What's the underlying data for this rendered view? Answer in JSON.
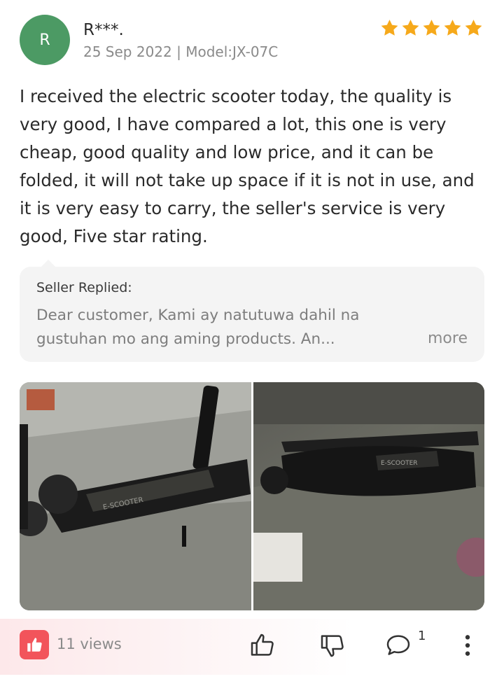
{
  "review": {
    "avatar_initial": "R",
    "username": "R***.",
    "meta": "25 Sep 2022 | Model:JX-07C",
    "rating": 5,
    "text": "I received the electric scooter today, the quality is very good, I have compared a lot, this one is very cheap, good quality and low price, and it can be folded, it will not take up space if it is not in use, and it is very easy to carry, the seller's service is very good, Five star rating."
  },
  "seller_reply": {
    "label": "Seller Replied:",
    "text": "Dear customer, Kami ay natutuwa dahil na gustuhan mo ang aming products. An...",
    "more_label": "more"
  },
  "photos": [
    {
      "description_icon": "scooter-photo-1",
      "deck_text": "E-SCOOTER"
    },
    {
      "description_icon": "scooter-photo-2",
      "deck_text": "E-SCOOTER"
    }
  ],
  "footer": {
    "views": "11 views",
    "comment_count": "1"
  },
  "colors": {
    "avatar": "#4c9a64",
    "star": "#f6a91b",
    "views_icon": "#f2545b"
  }
}
